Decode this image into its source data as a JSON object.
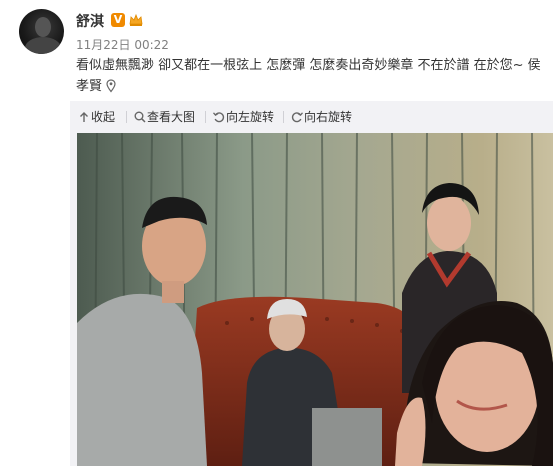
{
  "post": {
    "author": "舒淇",
    "verified_badge": "V",
    "timestamp": "11月22日 00:22",
    "text": "看似虛無飄渺 卻又都在一根弦上 怎麼彈 怎麼奏出奇妙樂章 不在於譜 在於您~ 侯孝賢"
  },
  "toolbar": {
    "collapse_label": "收起",
    "view_large_label": "查看大图",
    "rotate_left_label": "向左旋转",
    "rotate_right_label": "向右旋转"
  },
  "icons": {
    "collapse": "arrow-up-icon",
    "view_large": "magnifier-icon",
    "rotate_left": "rotate-left-icon",
    "rotate_right": "rotate-right-icon",
    "crown": "crown-badge-icon",
    "location": "location-pin-icon"
  },
  "colors": {
    "verified_badge": "#f08a00",
    "timestamp": "#808080",
    "panel_bg": "#f2f2f5"
  }
}
